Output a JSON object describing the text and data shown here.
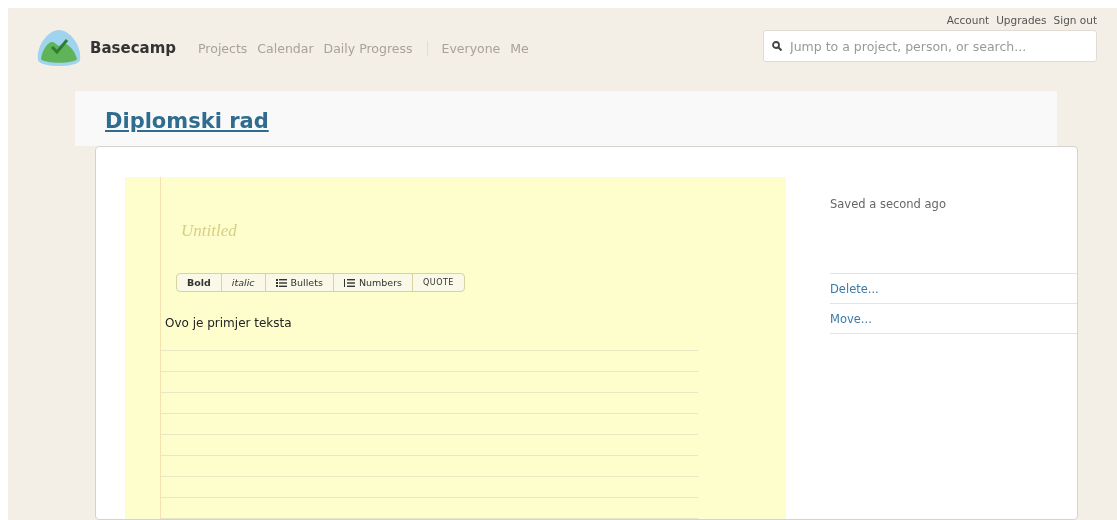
{
  "header": {
    "logo": "Basecamp",
    "nav": [
      {
        "label": "Projects",
        "group_start": false
      },
      {
        "label": "Calendar",
        "group_start": false
      },
      {
        "label": "Daily Progress",
        "group_start": false
      },
      {
        "label": "Everyone",
        "group_start": true
      },
      {
        "label": "Me",
        "group_start": false
      }
    ],
    "account_links": [
      "Account",
      "Upgrades",
      "Sign out"
    ],
    "search": {
      "placeholder": "Jump to a project, person, or search..."
    }
  },
  "project": {
    "title": "Diplomski rad"
  },
  "note": {
    "title_placeholder": "Untitled",
    "toolbar": [
      {
        "kind": "bold",
        "label": "Bold"
      },
      {
        "kind": "italic",
        "label": "italic"
      },
      {
        "kind": "bullets",
        "label": "Bullets"
      },
      {
        "kind": "numbers",
        "label": "Numbers"
      },
      {
        "kind": "quote",
        "label": "QUOTE"
      }
    ],
    "body": "Ovo je primjer teksta"
  },
  "sidebar": {
    "status": "Saved a second ago",
    "actions": [
      "Delete...",
      "Move..."
    ]
  }
}
